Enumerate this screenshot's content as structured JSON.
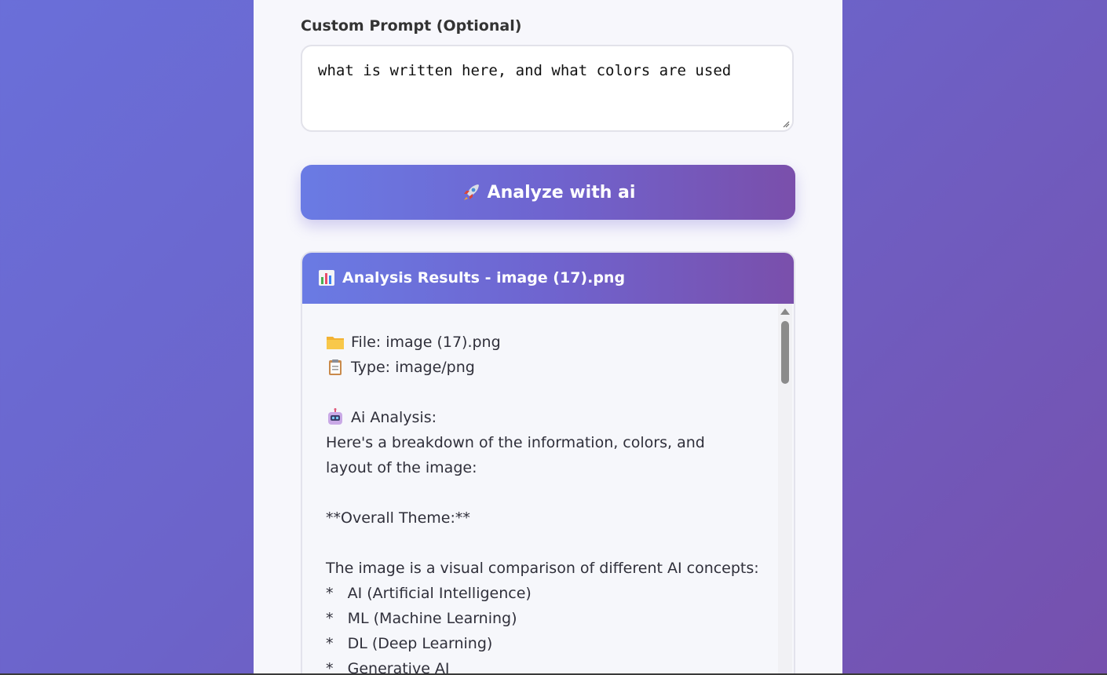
{
  "prompt": {
    "label": "Custom Prompt (Optional)",
    "value": "what is written here, and what colors are used"
  },
  "analyze_button": {
    "label": "Analyze with ai",
    "icon": "rocket-icon"
  },
  "results": {
    "header_title": "Analysis Results - image (17).png",
    "header_icon": "bar-chart-icon",
    "file_line": "File: image (17).png",
    "file_icon": "folder-icon",
    "type_line": "Type: image/png",
    "type_icon": "clipboard-icon",
    "analysis_heading": "Ai Analysis:",
    "analysis_icon": "robot-icon",
    "intro": "Here's a breakdown of the information, colors, and layout of the image:",
    "overall_theme": "**Overall Theme:**",
    "comparison_intro": "The image is a visual comparison of different AI concepts:",
    "bullets": [
      "*   AI (Artificial Intelligence)",
      "*   ML (Machine Learning)",
      "*   DL (Deep Learning)",
      "*   Generative AI"
    ]
  },
  "colors": {
    "accent_start": "#6a7be4",
    "accent_end": "#7a4fab"
  }
}
